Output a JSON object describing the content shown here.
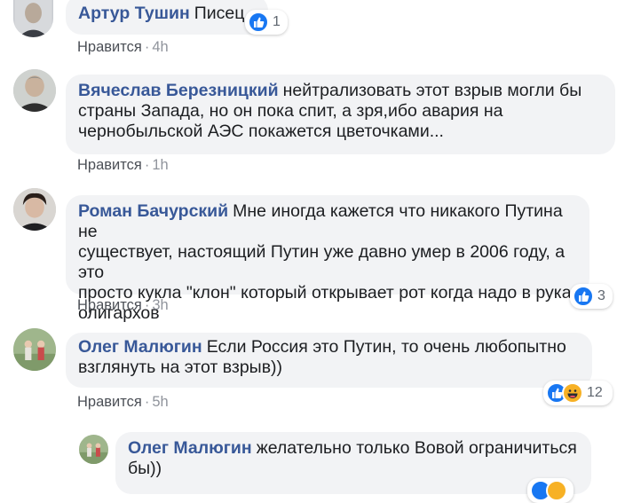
{
  "colors": {
    "author": "#385898",
    "bubble": "#f2f3f5",
    "meta": "#90949c",
    "like_blue": "#1877f2",
    "haha_yellow": "#f7b125"
  },
  "comments": [
    {
      "author": "Артур Тушин",
      "lines": [
        "Писец"
      ],
      "like_label": "Нравится",
      "time": "4h",
      "reactions": {
        "icons": [
          "like-icon"
        ],
        "count": "1"
      }
    },
    {
      "author": "Вячеслав Березницкий",
      "lines": [
        "нейтрализовать этот взрыв могли бы",
        "страны Запада, но он пока спит, а зря,ибо авария на",
        "чернобыльской АЭС покажется цветочками..."
      ],
      "like_label": "Нравится",
      "time": "1h"
    },
    {
      "author": "Роман Бачурский",
      "lines": [
        "Мне иногда кажется что никакого Путина не",
        "существует, настоящий Путин уже давно умер в 2006 году, а это",
        "просто кукла \"клон\" который открывает рот когда надо в руках",
        "олигархов"
      ],
      "like_label": "Нравится",
      "time": "3h",
      "reactions": {
        "icons": [
          "like-icon"
        ],
        "count": "3"
      }
    },
    {
      "author": "Олег Малюгин",
      "lines": [
        "Если Россия это Путин, то очень любопытно",
        "взглянуть на этот взрыв))"
      ],
      "like_label": "Нравится",
      "time": "5h",
      "reactions": {
        "icons": [
          "like-icon",
          "haha-icon"
        ],
        "count": "12"
      }
    },
    {
      "author": "Олег Малюгин",
      "lines": [
        "желательно только Вовой ограничиться",
        "бы))"
      ]
    }
  ]
}
